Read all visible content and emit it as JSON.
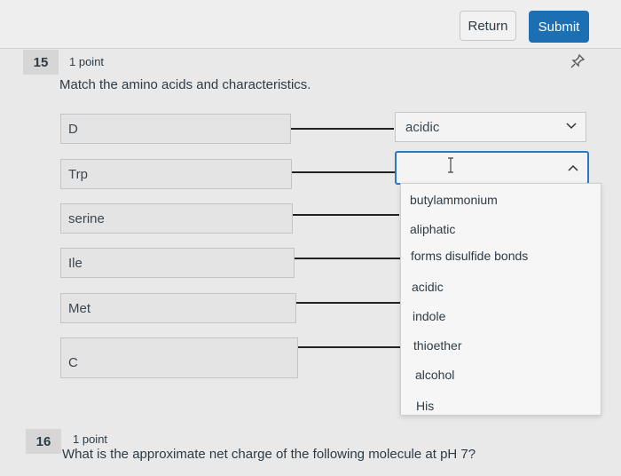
{
  "toolbar": {
    "return_label": "Return",
    "submit_label": "Submit"
  },
  "question15": {
    "number": "15",
    "points": "1 point",
    "prompt": "Match the amino acids and characteristics.",
    "left_items": [
      "D",
      "Trp",
      "serine",
      "Ile",
      "Met",
      "C"
    ],
    "first_answer": "acidic",
    "open_select_value": "",
    "options": [
      "butylammonium",
      "aliphatic",
      "forms disulfide bonds",
      "acidic",
      "indole",
      "thioether",
      "alcohol",
      "His"
    ]
  },
  "question16": {
    "number": "16",
    "points": "1 point",
    "prompt": "What is the approximate net charge of the following molecule at pH 7?"
  },
  "colors": {
    "accent": "#1c6fb3",
    "focus": "#2b78c5",
    "background": "#e9e9e9"
  }
}
